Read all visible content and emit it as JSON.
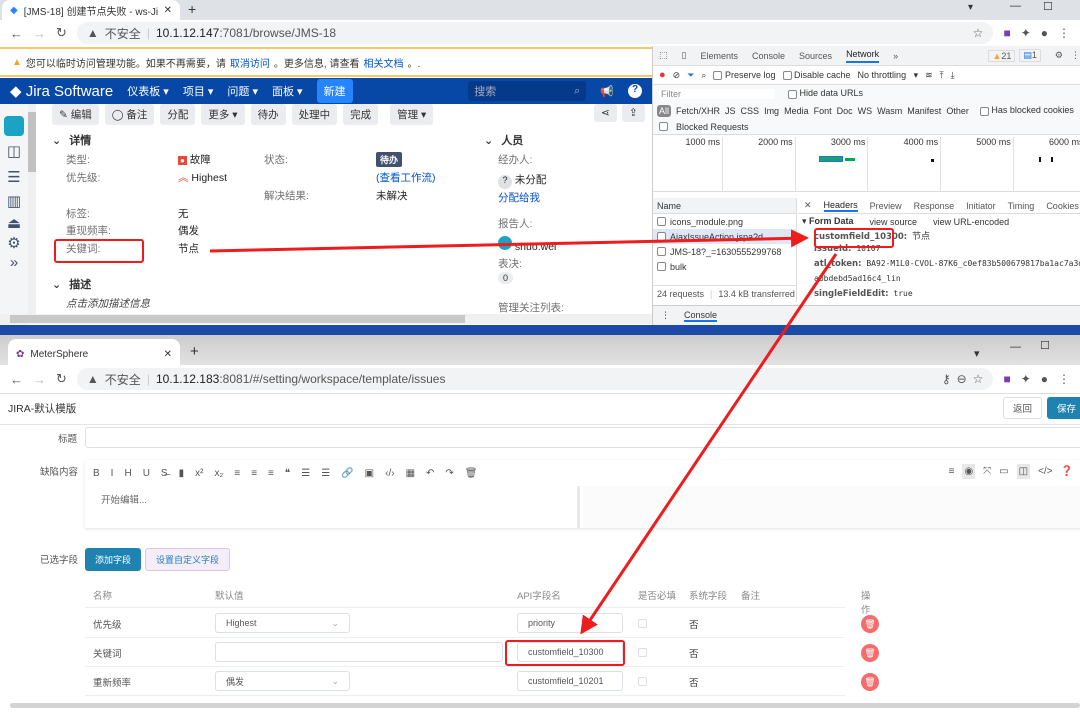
{
  "jira_browser": {
    "tab_title": "[JMS-18] 创建节点失败 - ws-Jira",
    "insecure": "不安全",
    "url_host": "10.1.12.147",
    "url_rest": ":7081/browse/JMS-18",
    "banner": {
      "text1": "您可以临时访问管理功能。如果不再需要，请",
      "link1": "取消访问",
      "text2": "。更多信息, 请查看",
      "link2": "相关文档",
      "text3": "。."
    },
    "nav": {
      "logo": "Jira Software",
      "items": [
        "仪表板",
        "项目",
        "问题",
        "面板"
      ],
      "create": "新建",
      "search_placeholder": "搜索"
    },
    "toolbar": [
      "编辑",
      "备注",
      "分配",
      "更多",
      "待办",
      "处理中",
      "完成",
      "管理"
    ],
    "details": {
      "section": "详情",
      "type_label": "类型:",
      "type_value": "故障",
      "priority_label": "优先级:",
      "priority_value": "Highest",
      "status_label": "状态:",
      "status_value": "待办",
      "workflow_link": "(查看工作流)",
      "resolution_label": "解决结果:",
      "resolution_value": "未解决",
      "labels_label": "标签:",
      "labels_value": "无",
      "frequency_label": "重现频率:",
      "frequency_value": "偶发",
      "keyword_label": "关键词:",
      "keyword_value": "节点",
      "desc_section": "描述",
      "desc_placeholder": "点击添加描述信息"
    },
    "people": {
      "section": "人员",
      "assignee_label": "经办人:",
      "assignee_value": "未分配",
      "assign_me": "分配给我",
      "reporter_label": "报告人:",
      "reporter_value": "shuo.wei",
      "votes_label": "表决:",
      "votes_value": "0",
      "watchers_label": "管理关注列表:"
    }
  },
  "devtools": {
    "tabs": [
      "Elements",
      "Console",
      "Sources",
      "Network"
    ],
    "active_tab": "Network",
    "warnings": "21",
    "messages": "1",
    "preserve_log": "Preserve log",
    "disable_cache": "Disable cache",
    "throttling": "No throttling",
    "filter_placeholder": "Filter",
    "hide_data_urls": "Hide data URLs",
    "types": [
      "All",
      "Fetch/XHR",
      "JS",
      "CSS",
      "Img",
      "Media",
      "Font",
      "Doc",
      "WS",
      "Wasm",
      "Manifest",
      "Other"
    ],
    "has_blocked_cookies": "Has blocked cookies",
    "blocked_requests": "Blocked Requests",
    "timeline": [
      "1000 ms",
      "2000 ms",
      "3000 ms",
      "4000 ms",
      "5000 ms",
      "6000 ms"
    ],
    "name_header": "Name",
    "requests": [
      "icons_module.png",
      "AjaxIssueAction.jspa?d...",
      "JMS-18?_=1630555299768",
      "bulk"
    ],
    "summary_requests": "24 requests",
    "summary_transferred": "13.4 kB transferred",
    "detail_tabs": [
      "Headers",
      "Preview",
      "Response",
      "Initiator",
      "Timing",
      "Cookies"
    ],
    "form_data_title": "Form Data",
    "view_source": "view source",
    "view_url_encoded": "view URL-encoded",
    "form": [
      {
        "key": "customfield_10300:",
        "value": "节点"
      },
      {
        "key": "issueId:",
        "value": "10107"
      },
      {
        "key": "atl_token:",
        "value": "BA92-M1L0-CVOL-87K6_c0ef83b500679817ba1ac7a3d9"
      },
      {
        "key": "",
        "value": "abbdebd5ad16c4_lin"
      },
      {
        "key": "singleFieldEdit:",
        "value": "true"
      }
    ],
    "drawer_tab": "Console"
  },
  "ms_browser": {
    "tab_title": "MeterSphere",
    "insecure": "不安全",
    "url_host": "10.1.12.183",
    "url_rest": ":8081/#/setting/workspace/template/issues",
    "page_title": "JIRA-默认模版",
    "back": "返回",
    "save": "保存",
    "title_label": "标题",
    "content_label": "缺陷内容",
    "editor_placeholder": "开始编辑...",
    "selected_fields_label": "已选字段",
    "add_field": "添加字段",
    "custom_field": "设置自定义字段",
    "columns": [
      "名称",
      "默认值",
      "API字段名",
      "是否必填",
      "系统字段",
      "备注",
      "操作"
    ],
    "rows": [
      {
        "name": "优先级",
        "default": "Highest",
        "api": "priority",
        "system": "否",
        "select": true
      },
      {
        "name": "关键词",
        "default": "",
        "api": "customfield_10300",
        "system": "否",
        "select": false
      },
      {
        "name": "重新频率",
        "default": "偶发",
        "api": "customfield_10201",
        "system": "否",
        "select": true
      }
    ]
  },
  "colors": {
    "jira_nav": "#0747a6",
    "annotation": "#ee1c1c",
    "ms_primary": "#1f83b1",
    "delete": "#f56c6c"
  }
}
